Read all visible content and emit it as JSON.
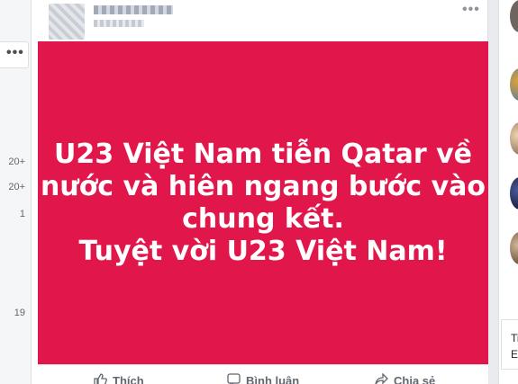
{
  "left_rail": {
    "more_label": "•••",
    "counts": [
      "20+",
      "20+",
      "1",
      "19"
    ]
  },
  "post": {
    "options_label": "•••",
    "banner_lines": [
      "U23 Việt Nam tiễn Qatar về",
      "nước và hiên ngang bước vào",
      "chung kết.",
      "Tuyệt vời U23 Việt Nam!"
    ],
    "banner_color": "#e1174b",
    "actions": {
      "like": "Thích",
      "comment": "Bình luận",
      "share": "Chia sẻ"
    }
  },
  "right_rail": {
    "box_line1": "Ti",
    "box_line2": "E"
  }
}
